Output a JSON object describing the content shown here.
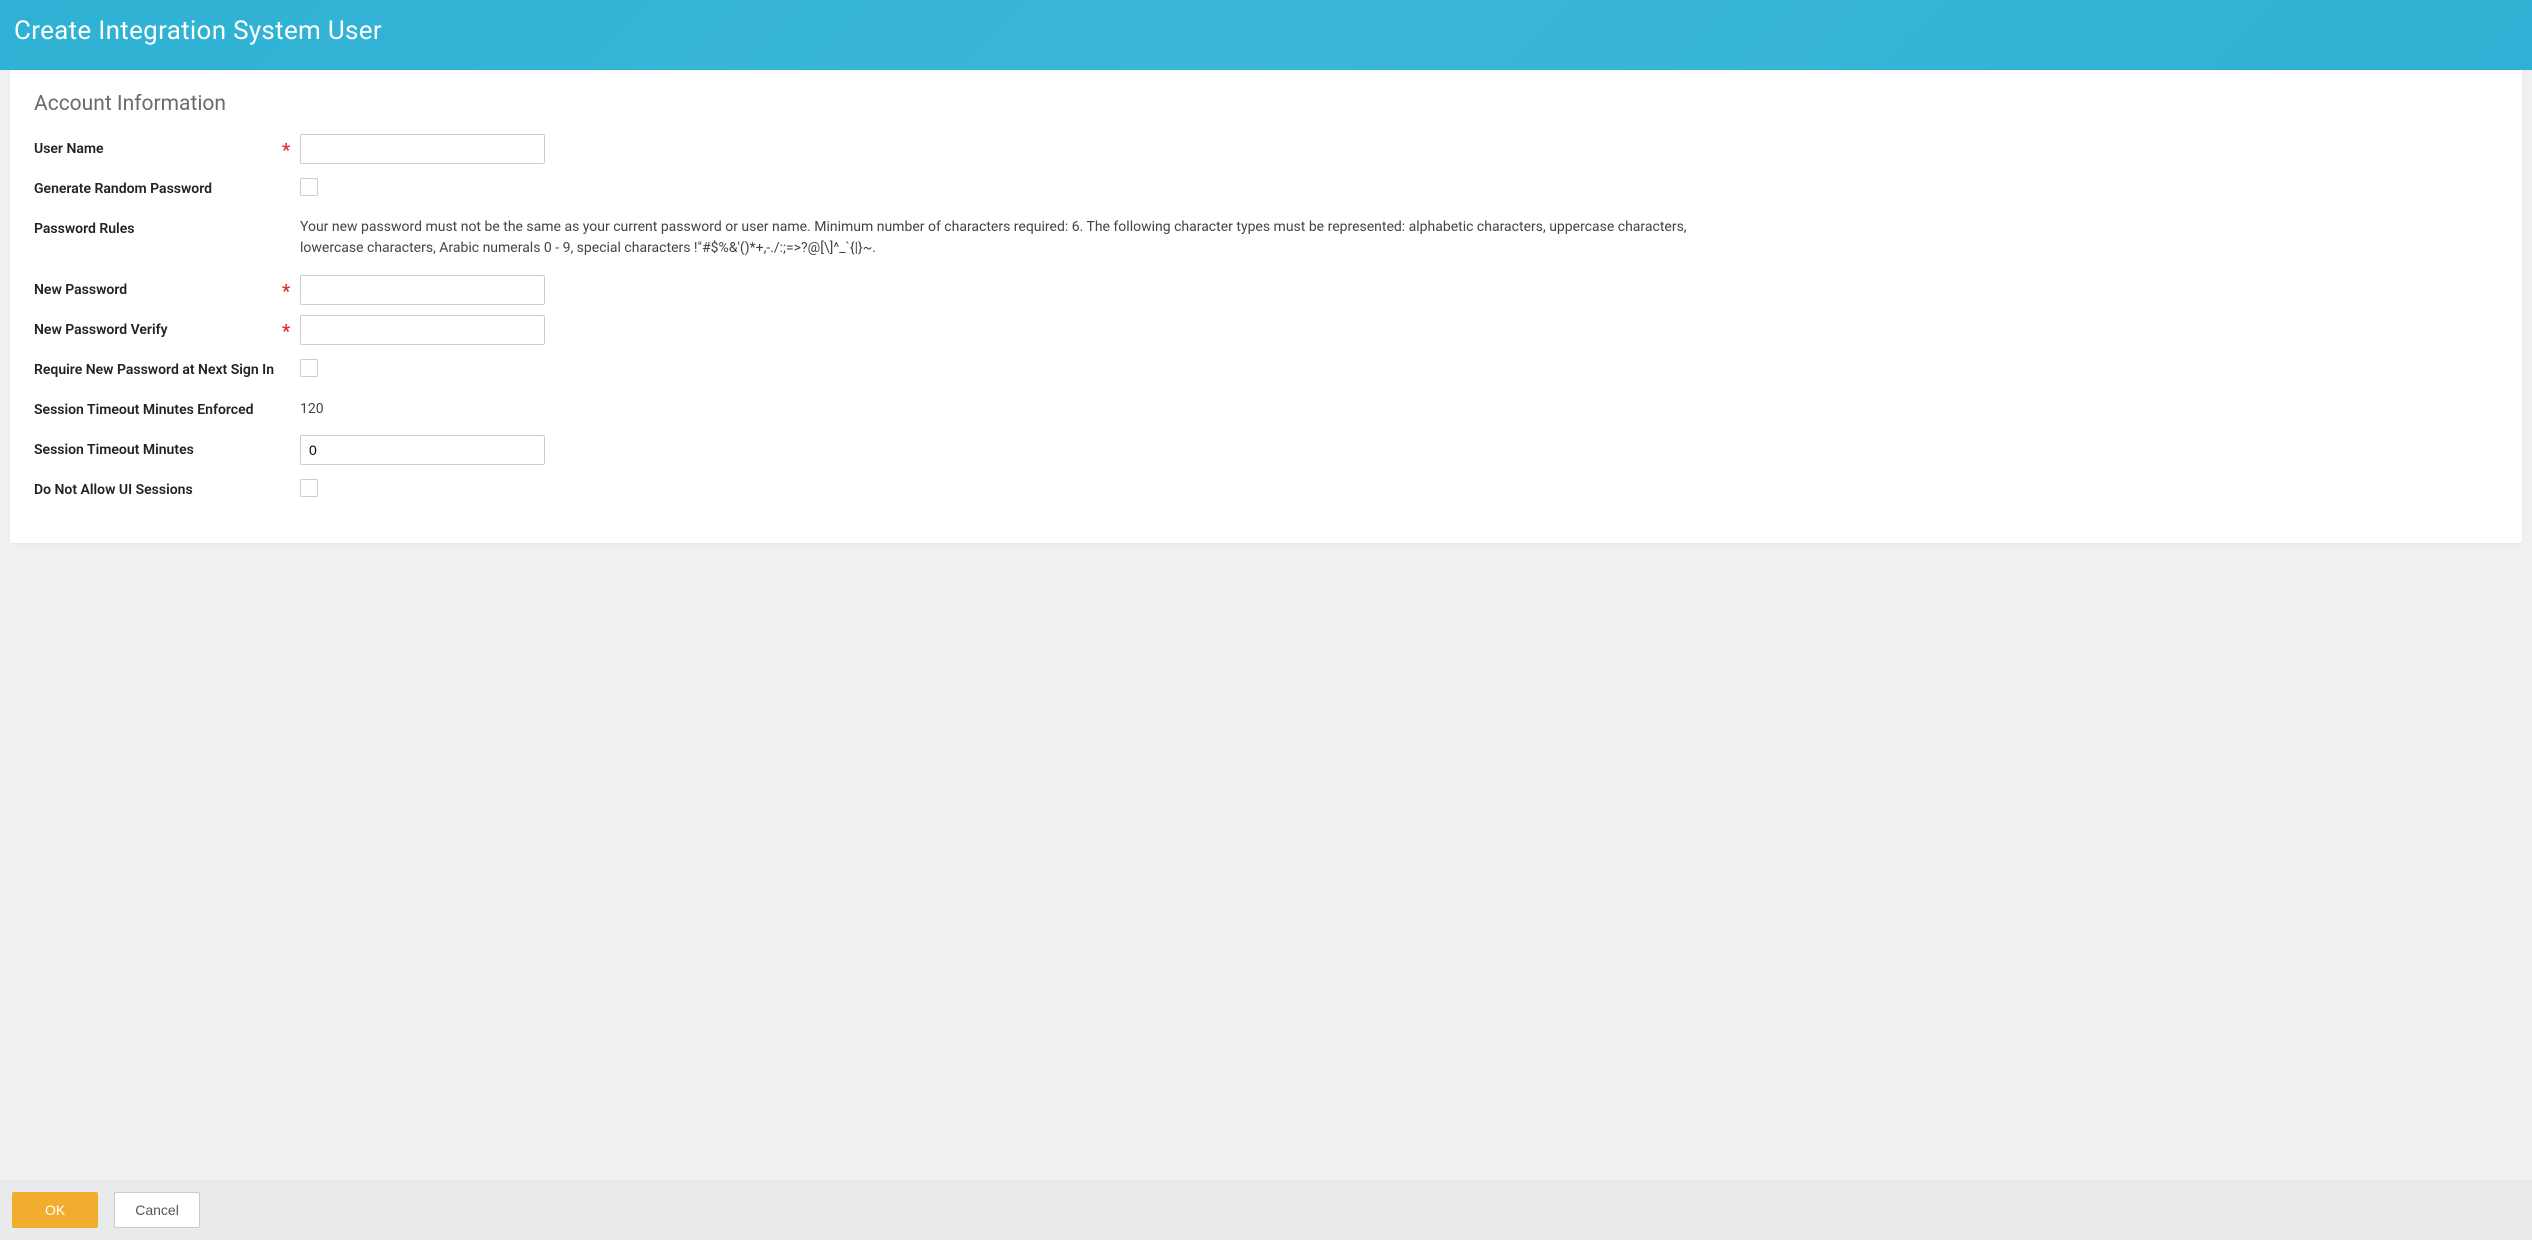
{
  "header": {
    "title": "Create Integration System User"
  },
  "section": {
    "title": "Account Information"
  },
  "form": {
    "username": {
      "label": "User Name",
      "value": ""
    },
    "generate_random_password": {
      "label": "Generate Random Password"
    },
    "password_rules": {
      "label": "Password Rules",
      "text": "Your new password must not be the same as your current password or user name. Minimum number of characters required: 6. The following character types must be represented: alphabetic characters, uppercase characters, lowercase characters, Arabic numerals 0 - 9, special characters !\"#$%&'()*+,-./:;=>?@[\\]^_`{|}~."
    },
    "new_password": {
      "label": "New Password",
      "value": ""
    },
    "new_password_verify": {
      "label": "New Password Verify",
      "value": ""
    },
    "require_new_password": {
      "label": "Require New Password at Next Sign In"
    },
    "session_timeout_enforced": {
      "label": "Session Timeout Minutes Enforced",
      "value": "120"
    },
    "session_timeout_minutes": {
      "label": "Session Timeout Minutes",
      "value": "0"
    },
    "do_not_allow_ui": {
      "label": "Do Not Allow UI Sessions"
    }
  },
  "footer": {
    "ok_label": "OK",
    "cancel_label": "Cancel"
  },
  "required_marker": "*"
}
